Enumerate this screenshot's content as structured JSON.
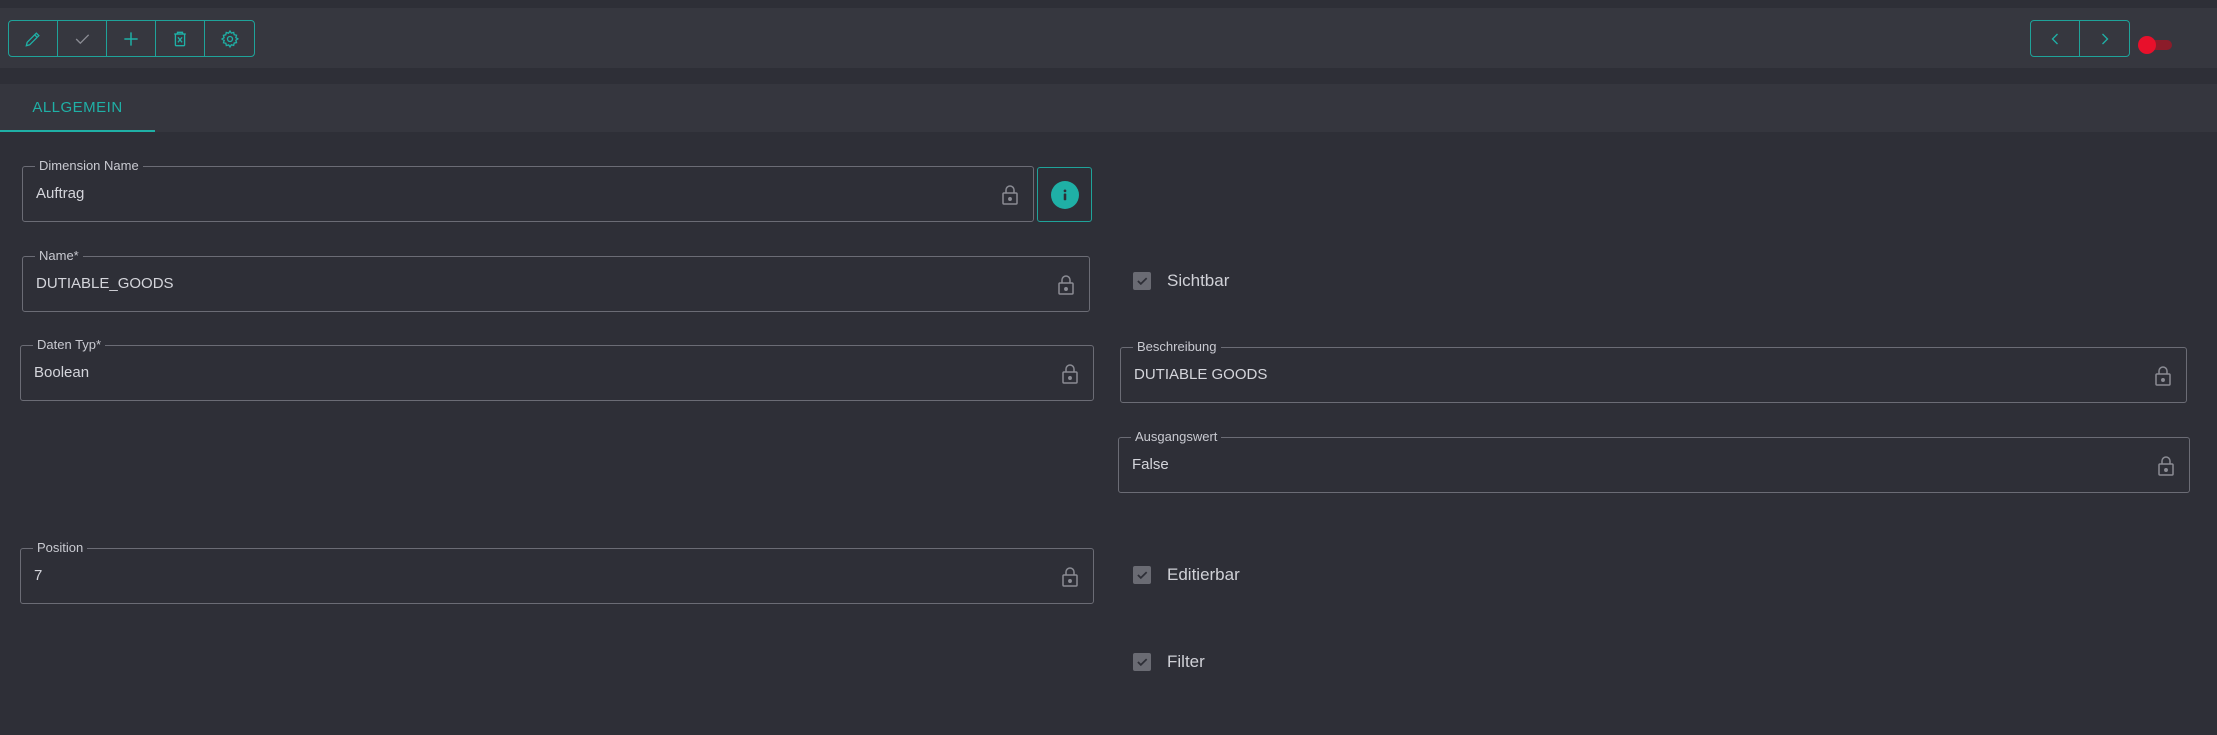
{
  "toolbar": {
    "left_buttons": [
      {
        "icon": "pencil-icon"
      },
      {
        "icon": "check-icon"
      },
      {
        "icon": "plus-icon"
      },
      {
        "icon": "delete-icon"
      },
      {
        "icon": "gear-icon"
      }
    ],
    "right_buttons": [
      {
        "icon": "chevron-left-icon"
      },
      {
        "icon": "chevron-right-icon"
      }
    ],
    "toggle": {
      "state": "off",
      "color": "#e8102b"
    }
  },
  "tabs": [
    {
      "label": "ALLGEMEIN",
      "active": true
    }
  ],
  "form": {
    "dimension_name": {
      "label": "Dimension Name",
      "value": "Auftrag"
    },
    "name": {
      "label": "Name*",
      "value": "DUTIABLE_GOODS"
    },
    "daten_typ": {
      "label": "Daten Typ*",
      "value": "Boolean"
    },
    "beschreibung": {
      "label": "Beschreibung",
      "value": "DUTIABLE GOODS"
    },
    "ausgangswert": {
      "label": "Ausgangswert",
      "value": "False"
    },
    "position": {
      "label": "Position",
      "value": "7"
    },
    "sichtbar": {
      "label": "Sichtbar",
      "checked": true
    },
    "editierbar": {
      "label": "Editierbar",
      "checked": true
    },
    "filter": {
      "label": "Filter",
      "checked": true
    }
  },
  "colors": {
    "accent": "#1fb0a6",
    "background": "#2e2f37",
    "toolbar": "#36373f"
  }
}
